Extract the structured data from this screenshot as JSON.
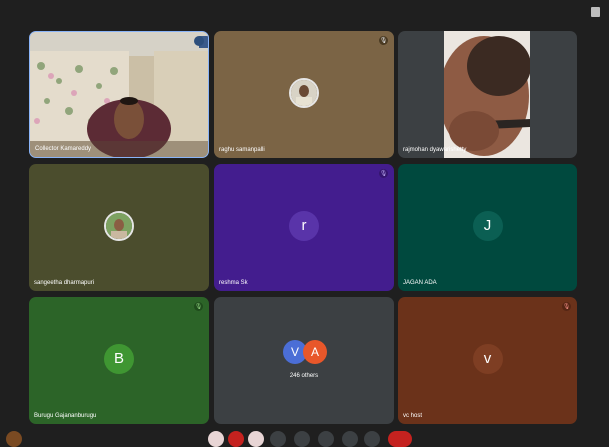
{
  "tiles": [
    {
      "name": "Collector Kamareddy",
      "kind": "video"
    },
    {
      "name": "raghu samanpalli",
      "kind": "photo-avatar",
      "bg": "#7b6445",
      "mic": "muted"
    },
    {
      "name": "rajmohan dyawarishetty",
      "kind": "video-partial"
    },
    {
      "name": "sangeetha dharmapuri",
      "kind": "photo-avatar",
      "bg": "#4b4d2d"
    },
    {
      "name": "reshma Sk",
      "kind": "letter",
      "letter": "r",
      "bg": "#431d8e",
      "avatar_bg": "#5934a9",
      "mic": "muted"
    },
    {
      "name": "JAGAN ADA",
      "kind": "letter",
      "letter": "J",
      "bg": "#00493e",
      "avatar_bg": "#0b5f53"
    },
    {
      "name": "Burugu Gajananburugu",
      "kind": "letter",
      "letter": "B",
      "bg": "#2c6428",
      "avatar_bg": "#3f9632",
      "mic": "muted"
    },
    {
      "name": "",
      "kind": "others",
      "letters": [
        "V",
        "A"
      ],
      "label": "246 others",
      "bg": "#3c4043"
    },
    {
      "name": "vc host",
      "kind": "letter",
      "letter": "v",
      "bg": "#6b321a",
      "avatar_bg": "#7e3e23",
      "mic": "muted"
    }
  ],
  "colors": {
    "background": "#1f1f1f",
    "muted_red": "#c5221f",
    "muted_mic_on_dark": "#8ab4f8"
  },
  "icons": [
    "more-options-icon",
    "mic-muted-icon"
  ]
}
